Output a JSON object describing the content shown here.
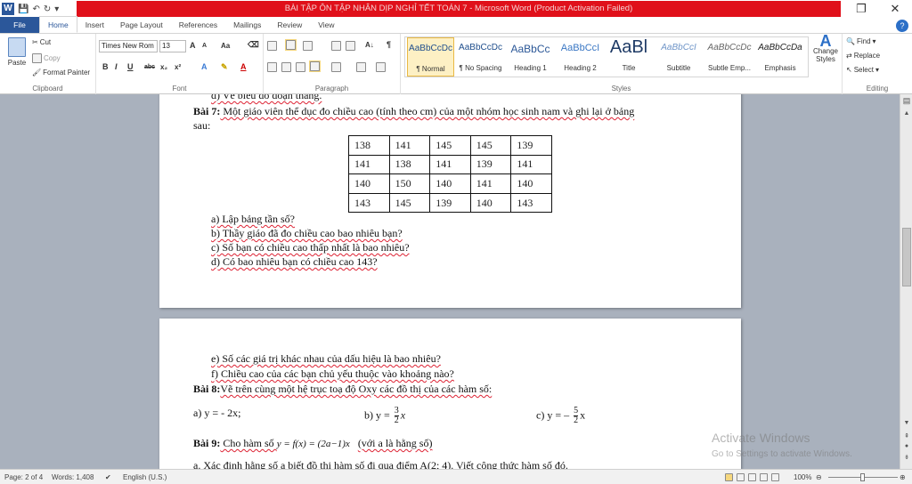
{
  "window": {
    "title": "BÀI TẬP ÔN TẬP NHÂN DỊP NGHỈ TẾT TOÁN 7 - Microsoft Word (Product Activation Failed)",
    "minimize": "–",
    "restore": "❐",
    "close": "✕"
  },
  "tabs": [
    "File",
    "Home",
    "Insert",
    "Page Layout",
    "References",
    "Mailings",
    "Review",
    "View"
  ],
  "help": "?",
  "clipboard": {
    "paste": "Paste",
    "cut": "Cut",
    "copy": "Copy",
    "format_painter": "Format Painter",
    "label": "Clipboard"
  },
  "font": {
    "name": "Times New Rom",
    "size": "13",
    "label": "Font",
    "grow": "A",
    "shrink": "A",
    "case": "Aa",
    "bold": "B",
    "italic": "I",
    "underline": "U",
    "strike": "abc",
    "subscript": "x₂",
    "superscript": "x²"
  },
  "paragraph": {
    "label": "Paragraph",
    "pilcrow": "¶",
    "sort": "A↓"
  },
  "styles": {
    "label": "Styles",
    "items": [
      {
        "sample": "AaBbCcDc",
        "name": "¶ Normal"
      },
      {
        "sample": "AaBbCcDc",
        "name": "¶ No Spacing"
      },
      {
        "sample": "AaBbCc",
        "name": "Heading 1"
      },
      {
        "sample": "AaBbCcI",
        "name": "Heading 2"
      },
      {
        "sample": "AaBl",
        "name": "Title"
      },
      {
        "sample": "AaBbCcI",
        "name": "Subtitle"
      },
      {
        "sample": "AaBbCcDc",
        "name": "Subtle Emp..."
      },
      {
        "sample": "AaBbCcDa",
        "name": "Emphasis"
      }
    ],
    "change_styles": "Change Styles"
  },
  "editing": {
    "label": "Editing",
    "find": "Find",
    "replace": "Replace",
    "select": "Select"
  },
  "document": {
    "partial_top": "d)  Vẽ biểu đồ đoạn thẳng.",
    "bai7_label": "Bài 7:",
    "bai7_text": " Một giáo viên thể dục đo chiều cao (tính theo cm) của một nhóm học sinh nam và ghi lại ở bảng",
    "bai7_text2": "sau:",
    "table": [
      [
        "138",
        "141",
        "145",
        "145",
        "139"
      ],
      [
        "141",
        "138",
        "141",
        "139",
        "141"
      ],
      [
        "140",
        "150",
        "140",
        "141",
        "140"
      ],
      [
        "143",
        "145",
        "139",
        "140",
        "143"
      ]
    ],
    "q_a": "a)  Lập bảng tần số?",
    "q_b": "b)  Thầy giáo đã đo chiều cao bao nhiêu bạn?",
    "q_c": "c)  Số bạn có chiều cao thấp nhất là bao nhiêu?",
    "q_d": "d)  Có bao nhiêu bạn có chiều cao 143?",
    "q_e": "e)  Số các giá trị khác nhau của dấu hiệu là bao nhiêu?",
    "q_f": "f)  Chiều cao của các bạn chủ yếu thuộc vào khoảng nào?",
    "bai8_label": "Bài 8:",
    "bai8_text": "Vẽ trên cùng một hệ trục toạ độ Oxy các đồ thị của các hàm số:",
    "f_a": "a) y = - 2x;",
    "f_b_pre": "b) y =",
    "f_b_num": "3",
    "f_b_den": "2",
    "f_b_var": "x",
    "f_c_pre": "c) y = –",
    "f_c_num": "5",
    "f_c_den": "2",
    "f_c_var": "x",
    "bai9_label": "Bài 9:",
    "bai9_text": " Cho hàm số ",
    "bai9_formula": "y = f(x) = (2a−1)x",
    "bai9_note": "(với a là hằng số)",
    "bai9_a": "a. Xác định hằng số a biết đồ thị hàm số đi qua điểm A(2; 4). Viết công thức hàm số đó."
  },
  "watermark": {
    "line1": "Activate Windows",
    "line2": "Go to Settings to activate Windows."
  },
  "status": {
    "page": "Page: 2 of 4",
    "words": "Words: 1,408",
    "language": "English (U.S.)",
    "zoom": "100%"
  }
}
